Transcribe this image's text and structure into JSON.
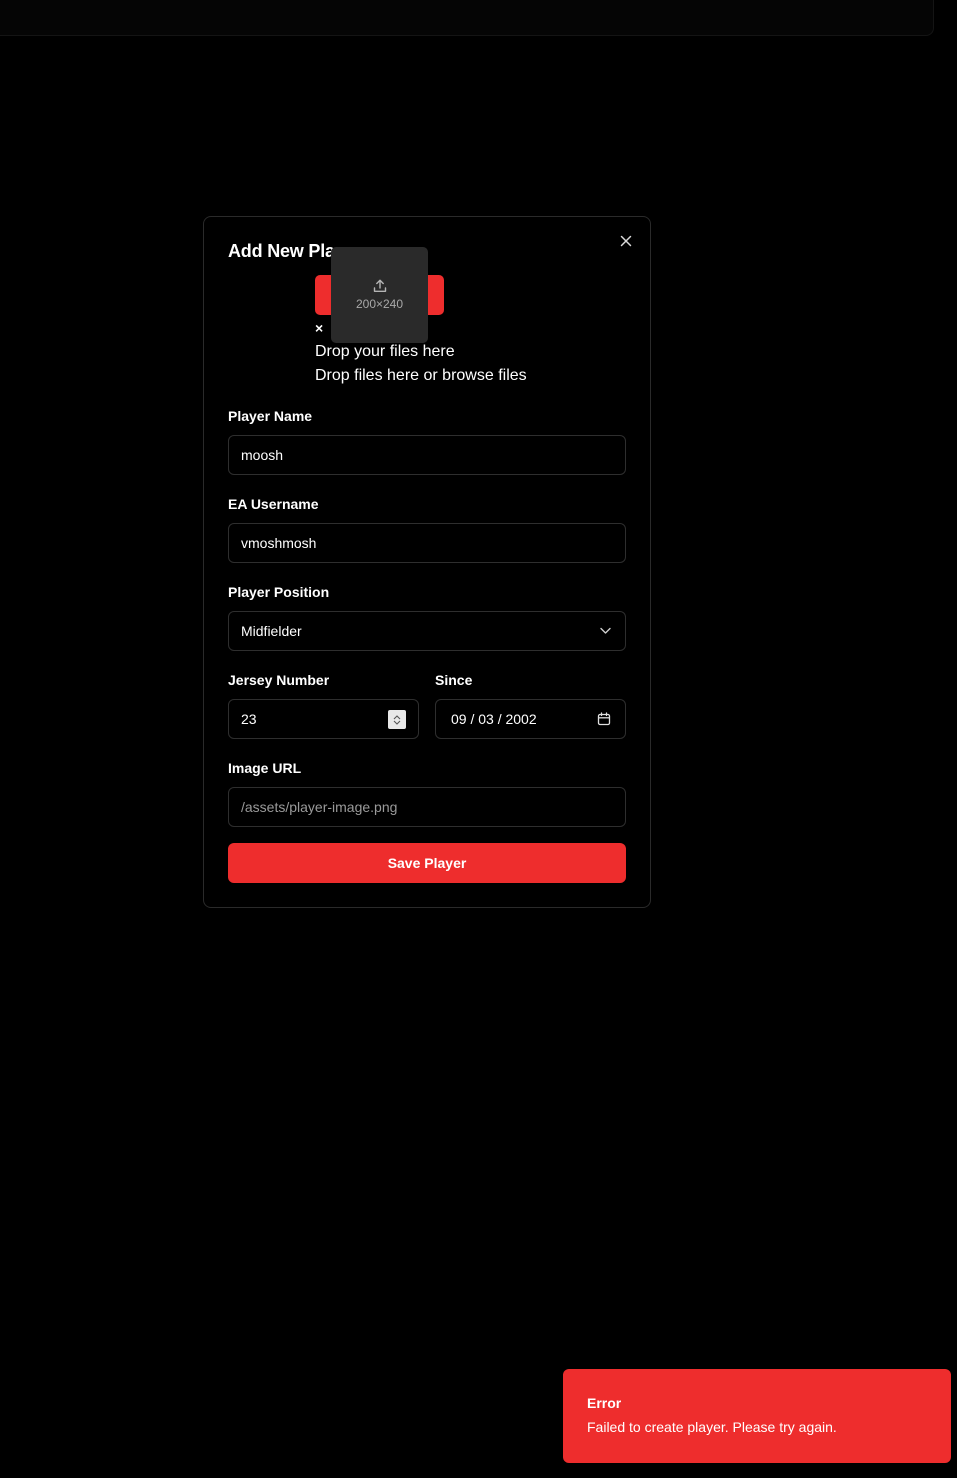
{
  "modal": {
    "title": "Add New Pla",
    "upload": {
      "thumb_size": "200×240",
      "remove": "×",
      "drop_title": "Drop your files here",
      "drop_subtitle": "Drop files here or browse files"
    },
    "fields": {
      "player_name": {
        "label": "Player Name",
        "value": "moosh"
      },
      "ea_username": {
        "label": "EA Username",
        "value": "vmoshmosh"
      },
      "player_position": {
        "label": "Player Position",
        "value": "Midfielder"
      },
      "jersey_number": {
        "label": "Jersey Number",
        "value": "23"
      },
      "since": {
        "label": "Since",
        "value": "09 / 03 / 2002"
      },
      "image_url": {
        "label": "Image URL",
        "placeholder": "/assets/player-image.png"
      }
    },
    "save_label": "Save Player"
  },
  "toast": {
    "title": "Error",
    "message": "Failed to create player. Please try again."
  },
  "colors": {
    "accent": "#ee2d2d",
    "background": "#000000",
    "border": "#2e2e2e"
  },
  "icons": [
    "close-icon",
    "upload-icon",
    "chevron-down-icon",
    "calendar-icon",
    "spinner-up-icon",
    "spinner-down-icon"
  ]
}
